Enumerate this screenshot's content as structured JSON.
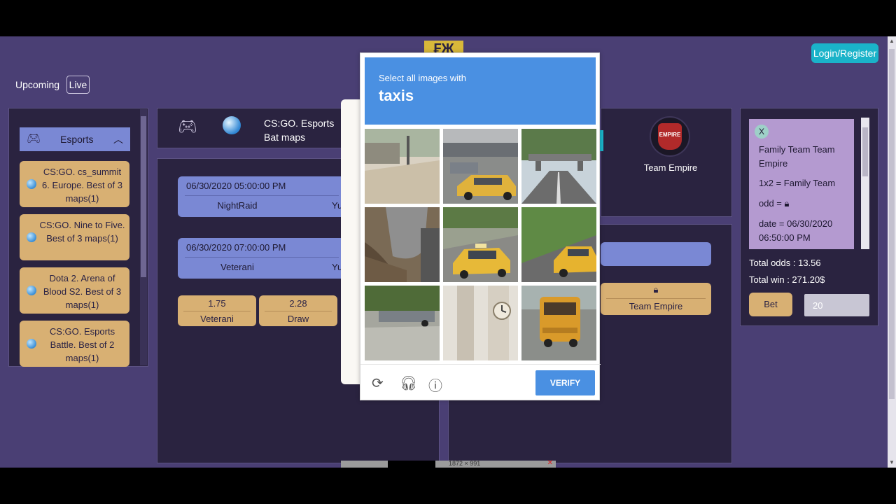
{
  "header": {
    "logo_text": "₣Ж",
    "login_label": "Login/Register"
  },
  "tabs": {
    "upcoming": "Upcoming",
    "live": "Live"
  },
  "sidebar": {
    "category": "Esports",
    "items": [
      {
        "label": "CS:GO. cs_summit 6. Europe. Best of 3 maps(1)"
      },
      {
        "label": "CS:GO. Nine to Five. Best of 3 maps(1)"
      },
      {
        "label": "Dota 2. Arena of Blood S2. Best of 3 maps(1)"
      },
      {
        "label": "CS:GO. Esports Battle. Best of 2 maps(1)"
      }
    ]
  },
  "event": {
    "title": "CS:GO. Esports Bat maps"
  },
  "matches": [
    {
      "datetime": "06/30/2020 05:00:00 PM",
      "team": "NightRaid",
      "tail": "Yu"
    },
    {
      "datetime": "06/30/2020 07:00:00 PM",
      "team": "Veterani",
      "tail": "Yu"
    }
  ],
  "odds": [
    {
      "value": "1.75",
      "name": "Veterani"
    },
    {
      "value": "2.28",
      "name": "Draw"
    }
  ],
  "right": {
    "team_name": "Team Empire",
    "logo_text": "EMPIRE",
    "odd_name": "Team Empire"
  },
  "slip": {
    "close": "X",
    "title": "Family Team Team Empire",
    "market": "1x2 = Family Team",
    "odd": "odd =",
    "date": "date = 06/30/2020 06:50:00 PM",
    "total_odds": "Total odds : 13.56",
    "total_win": "Total win : 271.20$",
    "bet_label": "Bet",
    "bet_amount": "20"
  },
  "captcha": {
    "instruction": "Select all images with",
    "target": "taxis",
    "verify_label": "VERIFY",
    "tiles": [
      {
        "name": "tile-street-corner",
        "taxi": false
      },
      {
        "name": "tile-taxi-parking-lot",
        "taxi": true
      },
      {
        "name": "tile-road-bridge",
        "taxi": false
      },
      {
        "name": "tile-tree-trunk",
        "taxi": false
      },
      {
        "name": "tile-taxi-road",
        "taxi": true
      },
      {
        "name": "tile-taxi-grass-road",
        "taxi": true
      },
      {
        "name": "tile-road-grass",
        "taxi": false
      },
      {
        "name": "tile-clock-tower",
        "taxi": false
      },
      {
        "name": "tile-school-bus",
        "taxi": false
      }
    ]
  },
  "taskbar": {
    "resolution": "1872 × 991"
  },
  "colors": {
    "bg": "#4a3f74",
    "panel": "#2a2340",
    "blue": "#7a88d4",
    "gold": "#d8b073",
    "accent": "#1ab3c9",
    "captcha_blue": "#4a90e2"
  }
}
